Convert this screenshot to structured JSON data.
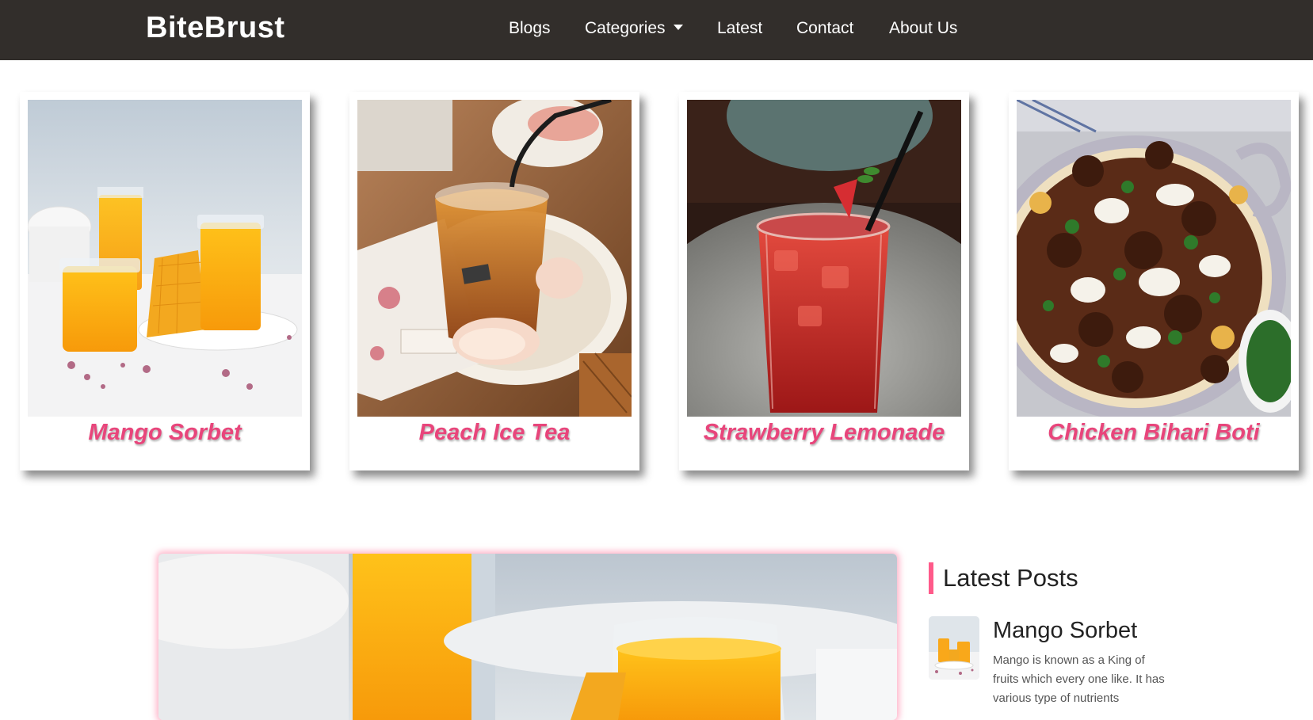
{
  "navbar": {
    "brand": "BiteBrust",
    "links": [
      "Blogs",
      "Categories",
      "Latest",
      "Contact",
      "About Us"
    ]
  },
  "cards": [
    {
      "title": "Mango Sorbet"
    },
    {
      "title": "Peach Ice Tea"
    },
    {
      "title": "Strawberry Lemonade"
    },
    {
      "title": "Chicken Bihari Boti"
    }
  ],
  "sidebar": {
    "heading": "Latest Posts",
    "posts": [
      {
        "title": "Mango Sorbet",
        "excerpt": "Mango is known as a King of fruits which every one like. It has various type of nutrients"
      }
    ]
  },
  "colors": {
    "navbar_bg": "#322e2b",
    "accent": "#e8457b",
    "heading_bar": "#ff5a8a"
  }
}
